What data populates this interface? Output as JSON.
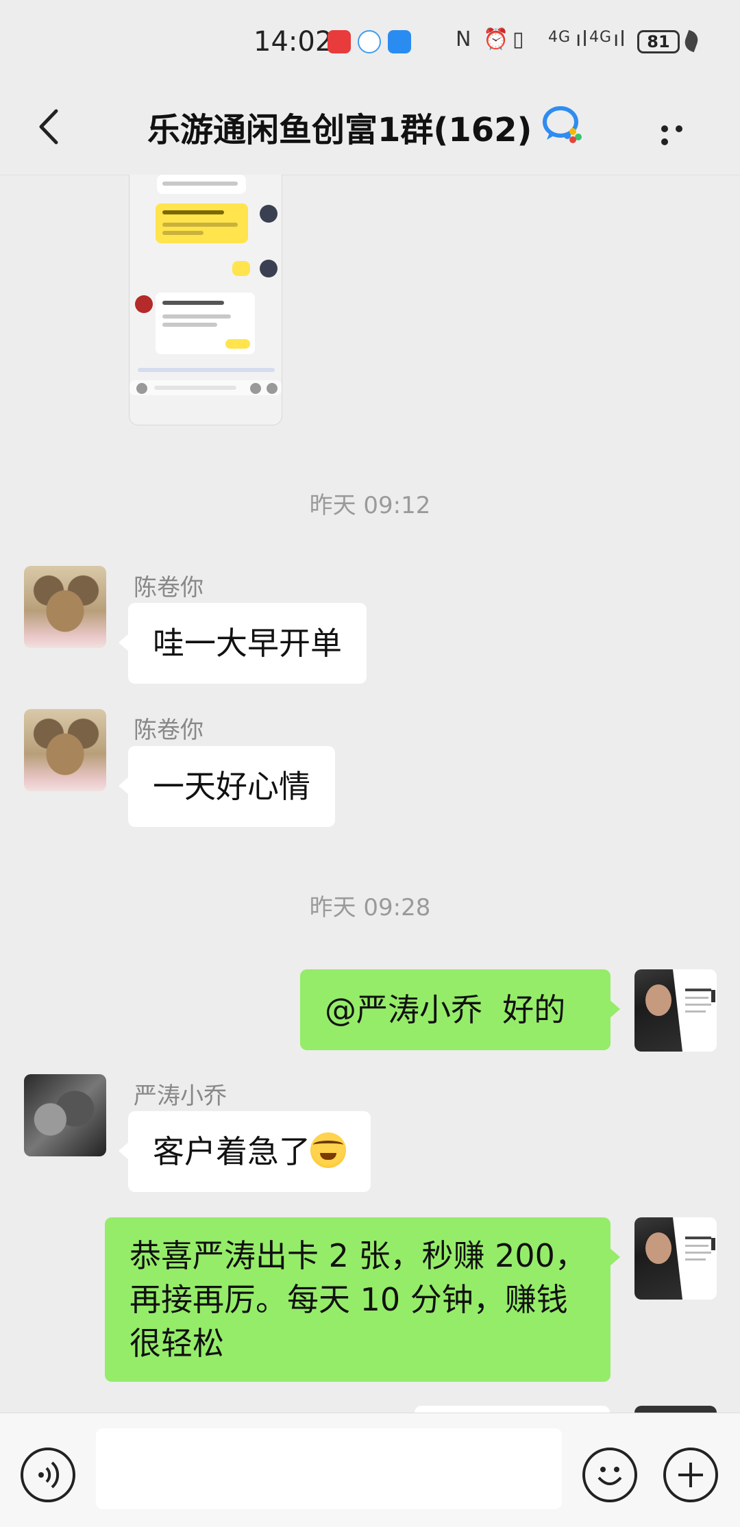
{
  "status_bar": {
    "time": "14:02",
    "signal_left": "4G",
    "signal_right": "4G",
    "battery": "81"
  },
  "header": {
    "title": "乐游通闲鱼创富1群(162)"
  },
  "messages": [
    {
      "type": "timestamp",
      "text": "昨天 09:12"
    },
    {
      "sender": "陈卷你",
      "text": "哇一大早开单"
    },
    {
      "sender": "陈卷你",
      "text": "一天好心情"
    },
    {
      "type": "timestamp",
      "text": "昨天 09:28"
    },
    {
      "sender": "self",
      "text": "@严涛小乔  好的"
    },
    {
      "sender": "严涛小乔",
      "text": "客户着急了"
    },
    {
      "sender": "self",
      "lines": [
        "恭喜严涛出卡 2 张，秒赚 200，",
        "再接再厉。每天 10 分钟，赚钱",
        "很轻松"
      ]
    }
  ],
  "input_bar": {
    "placeholder": ""
  },
  "colors": {
    "background": "#ededed",
    "out_bubble": "#95ec69",
    "in_bubble": "#ffffff"
  },
  "icons": [
    "back-icon",
    "wecom-icon",
    "more-icon",
    "voice-icon",
    "emoji-icon",
    "plus-icon"
  ]
}
